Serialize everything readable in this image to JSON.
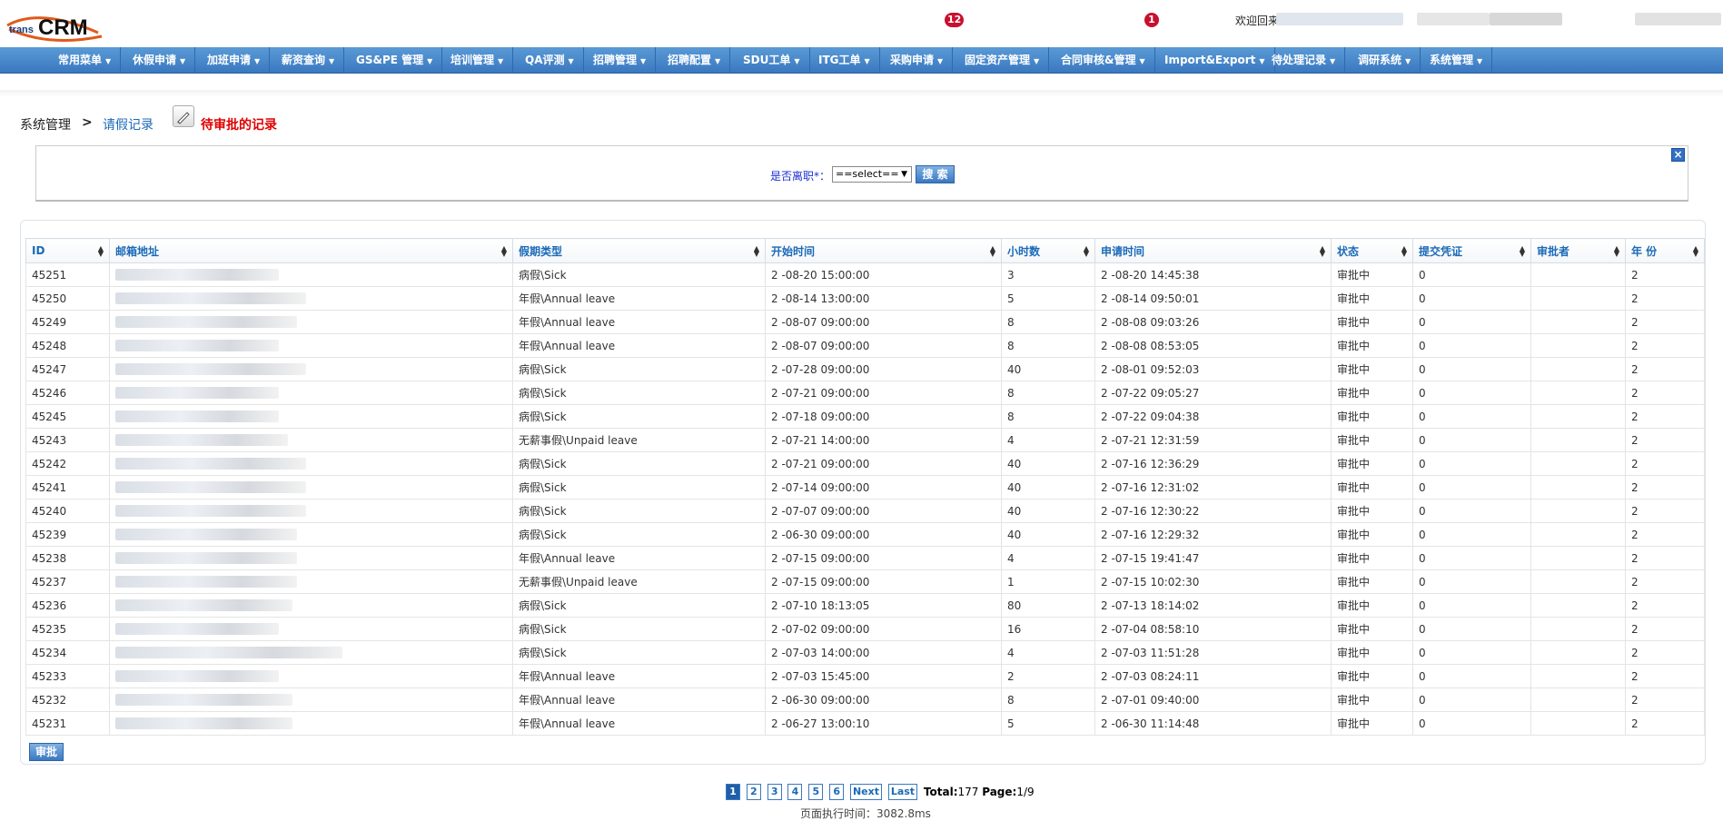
{
  "header": {
    "logo_prefix": "trans",
    "logo_main": "CRM",
    "notifications": [
      {
        "count": "12"
      },
      {
        "count": "1"
      }
    ],
    "welcome": "欢迎回来"
  },
  "nav": {
    "items": [
      {
        "label": "常用菜单"
      },
      {
        "label": "休假申请"
      },
      {
        "label": "加班申请"
      },
      {
        "label": "薪资查询"
      },
      {
        "label": "GS&PE 管理"
      },
      {
        "label": "培训管理"
      },
      {
        "label": "QA评测"
      },
      {
        "label": "招聘管理"
      },
      {
        "label": "招聘配置"
      },
      {
        "label": "SDU工单"
      },
      {
        "label": "ITG工单"
      },
      {
        "label": "采购申请"
      },
      {
        "label": "固定资产管理"
      },
      {
        "label": "合同审核&管理"
      },
      {
        "label": "Import&Export"
      },
      {
        "label": "待处理记录"
      },
      {
        "label": "调研系统"
      },
      {
        "label": "系统管理"
      }
    ]
  },
  "breadcrumb": {
    "root": "系统管理",
    "sep": ">",
    "link": "请假记录",
    "pending": "待审批的记录"
  },
  "search": {
    "label": "是否离职*：",
    "select_value": "==select==",
    "button": "搜 索"
  },
  "table": {
    "columns": [
      "ID",
      "邮箱地址",
      "假期类型",
      "开始时间",
      "小时数",
      "申请时间",
      "状态",
      "提交凭证",
      "审批者",
      "年 份"
    ],
    "rows": [
      {
        "id": "45251",
        "type": "病假\\Sick",
        "start": "2   -08-20 15:00:00",
        "hours": "3",
        "applied": "2   -08-20 14:45:38",
        "status": "审批中",
        "proof": "0",
        "year": "2"
      },
      {
        "id": "45250",
        "type": "年假\\Annual leave",
        "start": "2   -08-14 13:00:00",
        "hours": "5",
        "applied": "2   -08-14 09:50:01",
        "status": "审批中",
        "proof": "0",
        "year": "2"
      },
      {
        "id": "45249",
        "type": "年假\\Annual leave",
        "start": "2   -08-07 09:00:00",
        "hours": "8",
        "applied": "2   -08-08 09:03:26",
        "status": "审批中",
        "proof": "0",
        "year": "2"
      },
      {
        "id": "45248",
        "type": "年假\\Annual leave",
        "start": "2   -08-07 09:00:00",
        "hours": "8",
        "applied": "2   -08-08 08:53:05",
        "status": "审批中",
        "proof": "0",
        "year": "2"
      },
      {
        "id": "45247",
        "type": "病假\\Sick",
        "start": "2   -07-28 09:00:00",
        "hours": "40",
        "applied": "2   -08-01 09:52:03",
        "status": "审批中",
        "proof": "0",
        "year": "2"
      },
      {
        "id": "45246",
        "type": "病假\\Sick",
        "start": "2   -07-21 09:00:00",
        "hours": "8",
        "applied": "2   -07-22 09:05:27",
        "status": "审批中",
        "proof": "0",
        "year": "2"
      },
      {
        "id": "45245",
        "type": "病假\\Sick",
        "start": "2   -07-18 09:00:00",
        "hours": "8",
        "applied": "2   -07-22 09:04:38",
        "status": "审批中",
        "proof": "0",
        "year": "2"
      },
      {
        "id": "45243",
        "type": "无薪事假\\Unpaid leave",
        "start": "2   -07-21 14:00:00",
        "hours": "4",
        "applied": "2   -07-21 12:31:59",
        "status": "审批中",
        "proof": "0",
        "year": "2"
      },
      {
        "id": "45242",
        "type": "病假\\Sick",
        "start": "2   -07-21 09:00:00",
        "hours": "40",
        "applied": "2   -07-16 12:36:29",
        "status": "审批中",
        "proof": "0",
        "year": "2"
      },
      {
        "id": "45241",
        "type": "病假\\Sick",
        "start": "2   -07-14 09:00:00",
        "hours": "40",
        "applied": "2   -07-16 12:31:02",
        "status": "审批中",
        "proof": "0",
        "year": "2"
      },
      {
        "id": "45240",
        "type": "病假\\Sick",
        "start": "2   -07-07 09:00:00",
        "hours": "40",
        "applied": "2   -07-16 12:30:22",
        "status": "审批中",
        "proof": "0",
        "year": "2"
      },
      {
        "id": "45239",
        "type": "病假\\Sick",
        "start": "2   -06-30 09:00:00",
        "hours": "40",
        "applied": "2   -07-16 12:29:32",
        "status": "审批中",
        "proof": "0",
        "year": "2"
      },
      {
        "id": "45238",
        "type": "年假\\Annual leave",
        "start": "2   -07-15 09:00:00",
        "hours": "4",
        "applied": "2   -07-15 19:41:47",
        "status": "审批中",
        "proof": "0",
        "year": "2"
      },
      {
        "id": "45237",
        "type": "无薪事假\\Unpaid leave",
        "start": "2   -07-15 09:00:00",
        "hours": "1",
        "applied": "2   -07-15 10:02:30",
        "status": "审批中",
        "proof": "0",
        "year": "2"
      },
      {
        "id": "45236",
        "type": "病假\\Sick",
        "start": "2   -07-10 18:13:05",
        "hours": "80",
        "applied": "2   -07-13 18:14:02",
        "status": "审批中",
        "proof": "0",
        "year": "2"
      },
      {
        "id": "45235",
        "type": "病假\\Sick",
        "start": "2   -07-02 09:00:00",
        "hours": "16",
        "applied": "2   -07-04 08:58:10",
        "status": "审批中",
        "proof": "0",
        "year": "2"
      },
      {
        "id": "45234",
        "type": "病假\\Sick",
        "start": "2   -07-03 14:00:00",
        "hours": "4",
        "applied": "2   -07-03 11:51:28",
        "status": "审批中",
        "proof": "0",
        "year": "2"
      },
      {
        "id": "45233",
        "type": "年假\\Annual leave",
        "start": "2   -07-03 15:45:00",
        "hours": "2",
        "applied": "2   -07-03 08:24:11",
        "status": "审批中",
        "proof": "0",
        "year": "2"
      },
      {
        "id": "45232",
        "type": "年假\\Annual leave",
        "start": "2   -06-30 09:00:00",
        "hours": "8",
        "applied": "2   -07-01 09:40:00",
        "status": "审批中",
        "proof": "0",
        "year": "2"
      },
      {
        "id": "45231",
        "type": "年假\\Annual leave",
        "start": "2   -06-27 13:00:10",
        "hours": "5",
        "applied": "2   -06-30 11:14:48",
        "status": "审批中",
        "proof": "0",
        "year": "2"
      }
    ]
  },
  "actions": {
    "approve": "审批"
  },
  "pagination": {
    "pages": [
      "1",
      "2",
      "3",
      "4",
      "5",
      "6"
    ],
    "current": "1",
    "next": "Next",
    "last": "Last",
    "total_label": "Total:",
    "total": "177",
    "page_label": "Page:",
    "page": "1/9"
  },
  "footer": {
    "exec_time": "页面执行时间：3082.8ms"
  },
  "colors": {
    "nav": "#3a78c0",
    "link": "#1a6ab8",
    "alert": "#e10000",
    "badge": "#c8102e"
  }
}
